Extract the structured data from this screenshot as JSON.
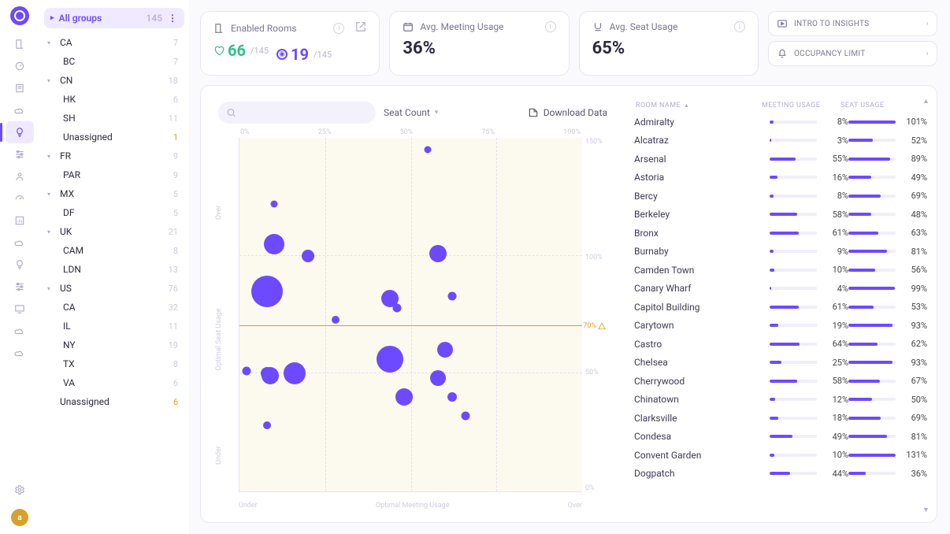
{
  "rail": {
    "icons": [
      "door-icon",
      "dashboard-icon",
      "doc-icon",
      "cloud-icon",
      "bulb-icon",
      "sliders-icon",
      "person-icon",
      "gauge-icon",
      "report-icon",
      "cloud-icon",
      "bulb-icon",
      "sliders-icon",
      "monitor-icon",
      "cloud-icon",
      "cloud-icon"
    ],
    "active_index": 4,
    "avatar_initial": "a"
  },
  "sidebar": {
    "all_label": "All groups",
    "all_count": "145",
    "groups": [
      {
        "code": "CA",
        "count": "7",
        "children": [
          {
            "code": "BC",
            "count": "7"
          }
        ]
      },
      {
        "code": "CN",
        "count": "18",
        "children": [
          {
            "code": "HK",
            "count": "6"
          },
          {
            "code": "SH",
            "count": "11"
          },
          {
            "code": "Unassigned",
            "count": "1",
            "warn": true
          }
        ]
      },
      {
        "code": "FR",
        "count": "9",
        "children": [
          {
            "code": "PAR",
            "count": "9"
          }
        ]
      },
      {
        "code": "MX",
        "count": "5",
        "children": [
          {
            "code": "DF",
            "count": "5"
          }
        ]
      },
      {
        "code": "UK",
        "count": "21",
        "children": [
          {
            "code": "CAM",
            "count": "8"
          },
          {
            "code": "LDN",
            "count": "13"
          }
        ]
      },
      {
        "code": "US",
        "count": "76",
        "children": [
          {
            "code": "CA",
            "count": "32"
          },
          {
            "code": "IL",
            "count": "11"
          },
          {
            "code": "NY",
            "count": "19"
          },
          {
            "code": "TX",
            "count": "8"
          },
          {
            "code": "VA",
            "count": "6"
          }
        ]
      },
      {
        "code": "Unassigned",
        "count": "6",
        "warn": true,
        "nochildcaret": true
      }
    ]
  },
  "kpi": {
    "enabled_label": "Enabled Rooms",
    "enabled_ok": "66",
    "enabled_warn": "19",
    "enabled_of": "/145",
    "avg_meeting_label": "Avg. Meeting Usage",
    "avg_meeting_value": "36%",
    "avg_seat_label": "Avg. Seat Usage",
    "avg_seat_value": "65%"
  },
  "side_links": {
    "intro": "INTRO TO INSIGHTS",
    "occ": "OCCUPANCY LIMIT"
  },
  "toolbar": {
    "seat_count": "Seat Count",
    "download": "Download Data",
    "search_placeholder": ""
  },
  "chart_data": {
    "type": "scatter",
    "xlabel_segments": [
      "Under",
      "Optimal Meeting Usage",
      "Over"
    ],
    "ylabels": [
      "Under",
      "Optimal Seat Usage",
      "Over"
    ],
    "x_ticks": [
      "0%",
      "25%",
      "50%",
      "75%",
      "100%"
    ],
    "y_ticks_right": [
      "150%",
      "100%",
      "50%",
      "0%"
    ],
    "threshold_y_label": "70%",
    "xlim": [
      0,
      100
    ],
    "ylim": [
      0,
      150
    ],
    "size_legend": "Seat Count",
    "points": [
      {
        "x": 55,
        "y": 145,
        "size": 9
      },
      {
        "x": 10,
        "y": 122,
        "size": 9
      },
      {
        "x": 10,
        "y": 105,
        "size": 26
      },
      {
        "x": 20,
        "y": 100,
        "size": 16
      },
      {
        "x": 58,
        "y": 101,
        "size": 22
      },
      {
        "x": 44,
        "y": 82,
        "size": 22
      },
      {
        "x": 46,
        "y": 78,
        "size": 11
      },
      {
        "x": 62,
        "y": 83,
        "size": 11
      },
      {
        "x": 8,
        "y": 85,
        "size": 40
      },
      {
        "x": 28,
        "y": 73,
        "size": 10
      },
      {
        "x": 44,
        "y": 56,
        "size": 34
      },
      {
        "x": 60,
        "y": 60,
        "size": 20
      },
      {
        "x": 58,
        "y": 48,
        "size": 20
      },
      {
        "x": 2,
        "y": 51,
        "size": 11
      },
      {
        "x": 9,
        "y": 49,
        "size": 22
      },
      {
        "x": 16,
        "y": 50,
        "size": 28
      },
      {
        "x": 8,
        "y": 50,
        "size": 16
      },
      {
        "x": 48,
        "y": 40,
        "size": 22
      },
      {
        "x": 62,
        "y": 40,
        "size": 12
      },
      {
        "x": 66,
        "y": 32,
        "size": 11
      },
      {
        "x": 8,
        "y": 28,
        "size": 10
      }
    ]
  },
  "table": {
    "headers": {
      "name": "ROOM NAME",
      "meeting": "MEETING USAGE",
      "seat": "SEAT USAGE"
    },
    "rows": [
      {
        "name": "Admiralty",
        "meeting": 8,
        "seat": 101
      },
      {
        "name": "Alcatraz",
        "meeting": 3,
        "seat": 52
      },
      {
        "name": "Arsenal",
        "meeting": 55,
        "seat": 89
      },
      {
        "name": "Astoria",
        "meeting": 16,
        "seat": 49
      },
      {
        "name": "Bercy",
        "meeting": 8,
        "seat": 69
      },
      {
        "name": "Berkeley",
        "meeting": 58,
        "seat": 48
      },
      {
        "name": "Bronx",
        "meeting": 61,
        "seat": 63
      },
      {
        "name": "Burnaby",
        "meeting": 9,
        "seat": 81
      },
      {
        "name": "Camden Town",
        "meeting": 10,
        "seat": 56
      },
      {
        "name": "Canary Wharf",
        "meeting": 4,
        "seat": 99
      },
      {
        "name": "Capitol Building",
        "meeting": 61,
        "seat": 53
      },
      {
        "name": "Carytown",
        "meeting": 19,
        "seat": 93
      },
      {
        "name": "Castro",
        "meeting": 64,
        "seat": 62
      },
      {
        "name": "Chelsea",
        "meeting": 25,
        "seat": 93
      },
      {
        "name": "Cherrywood",
        "meeting": 58,
        "seat": 67
      },
      {
        "name": "Chinatown",
        "meeting": 12,
        "seat": 50
      },
      {
        "name": "Clarksville",
        "meeting": 18,
        "seat": 69
      },
      {
        "name": "Condesa",
        "meeting": 49,
        "seat": 81
      },
      {
        "name": "Convent Garden",
        "meeting": 10,
        "seat": 131
      },
      {
        "name": "Dogpatch",
        "meeting": 44,
        "seat": 36
      }
    ]
  }
}
